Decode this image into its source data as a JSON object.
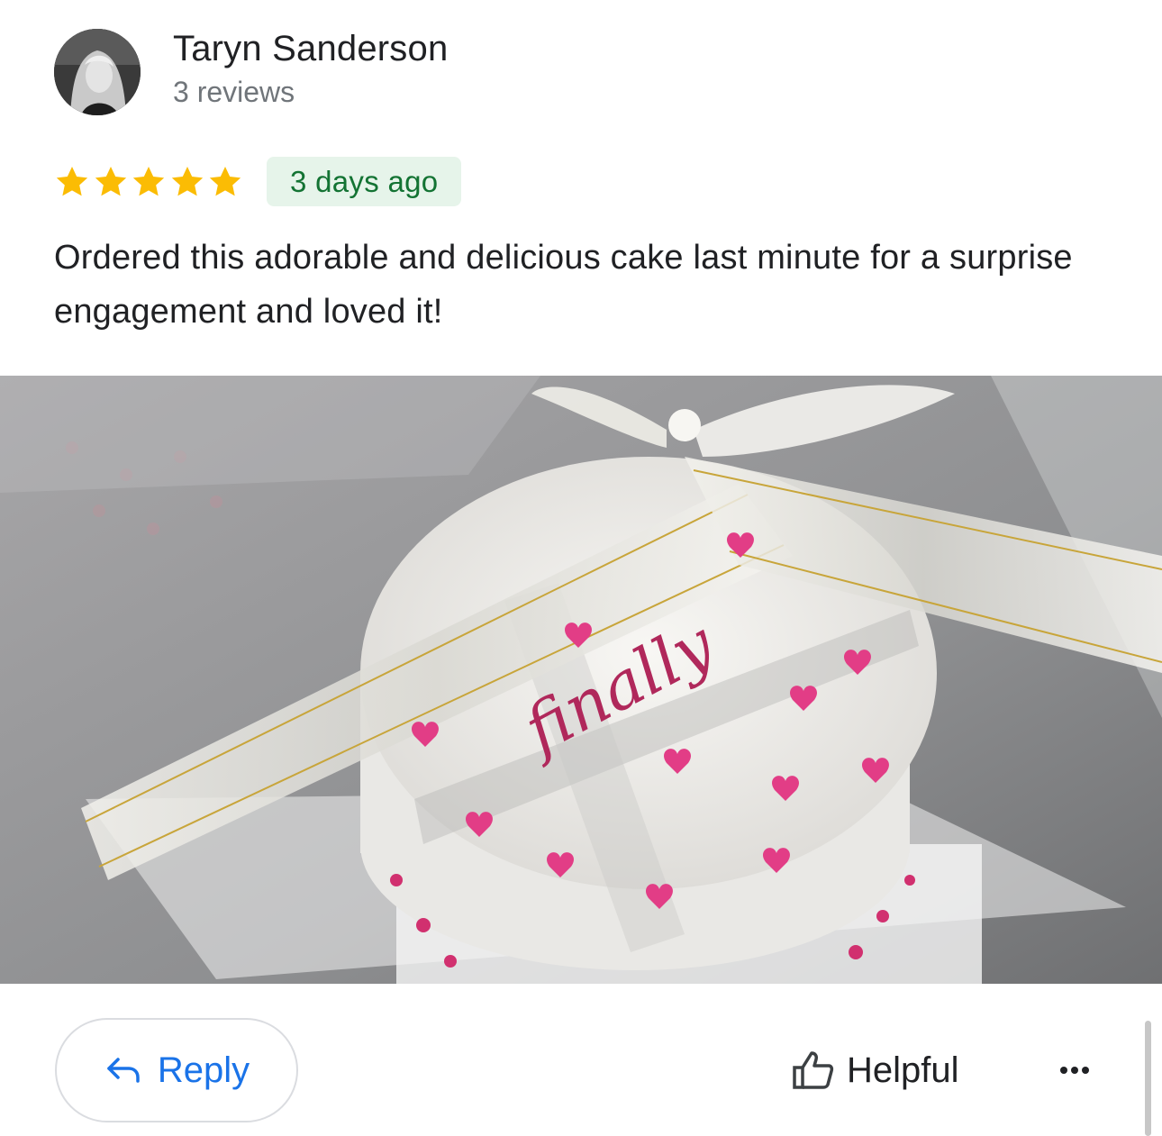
{
  "review": {
    "author_name": "Taryn Sanderson",
    "author_reviews": "3 reviews",
    "rating": 5,
    "rating_max": 5,
    "date": "3 days ago",
    "text": "Ordered this adorable and delicious cake last minute for a surprise engagement and loved it!",
    "photo": {
      "cake_writing": "finally"
    }
  },
  "actions": {
    "reply_label": "Reply",
    "helpful_label": "Helpful",
    "more_icon": "more-horizontal-icon"
  },
  "colors": {
    "star": "#fbbc04",
    "badge_bg": "#e6f4ea",
    "badge_text": "#137333",
    "reply_blue": "#1a73e8"
  }
}
